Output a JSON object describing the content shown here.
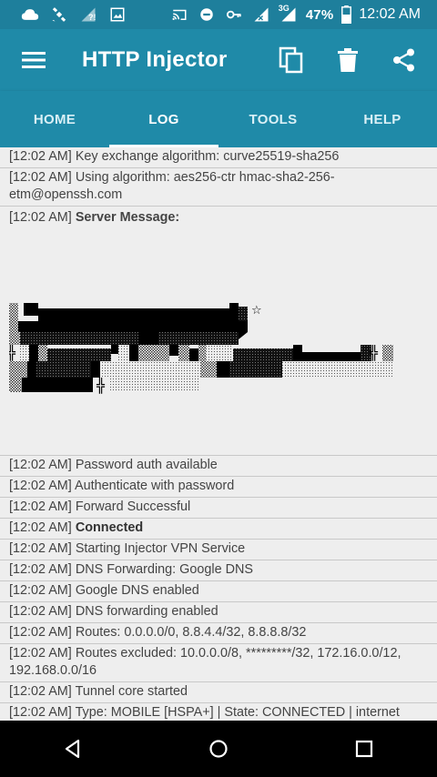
{
  "status_bar": {
    "left_icons": [
      "cloud-icon",
      "satellite-icon",
      "wifi-question-icon",
      "image-alert-icon"
    ],
    "right_icons": [
      "cast-icon",
      "do-not-disturb-icon",
      "vpn-key-icon",
      "signal-icon",
      "signal-3g-icon",
      "battery-icon"
    ],
    "network_type": "3G",
    "battery_percent": "47%",
    "time": "12:02 AM"
  },
  "app_bar": {
    "title": "HTTP Injector",
    "actions": [
      "copy-icon",
      "delete-icon",
      "share-icon"
    ]
  },
  "tabs": [
    {
      "label": "HOME",
      "active": false
    },
    {
      "label": "LOG",
      "active": true
    },
    {
      "label": "TOOLS",
      "active": false
    },
    {
      "label": "HELP",
      "active": false
    }
  ],
  "log": {
    "top_rows": [
      {
        "time": "[12:02 AM]",
        "text": "Key exchange algorithm: curve25519-sha256"
      },
      {
        "time": "[12:02 AM]",
        "text": "Using algorithm: aes256-ctr hmac-sha2-256-etm@openssh.com"
      }
    ],
    "server_message": {
      "time": "[12:02 AM]",
      "label": "Server Message:"
    },
    "bottom_rows": [
      {
        "time": "[12:02 AM]",
        "text": "Password auth available"
      },
      {
        "time": "[12:02 AM]",
        "text": "Authenticate with password"
      },
      {
        "time": "[12:02 AM]",
        "text": "Forward Successful"
      },
      {
        "time": "[12:02 AM]",
        "bold": "Connected"
      },
      {
        "time": "[12:02 AM]",
        "text": "Starting Injector VPN Service"
      },
      {
        "time": "[12:02 AM]",
        "text": "DNS Forwarding: Google DNS"
      },
      {
        "time": "[12:02 AM]",
        "text": "Google DNS enabled"
      },
      {
        "time": "[12:02 AM]",
        "text": "DNS forwarding enabled"
      },
      {
        "time": "[12:02 AM]",
        "text": "Routes: 0.0.0.0/0, 8.8.4.4/32, 8.8.8.8/32"
      },
      {
        "time": "[12:02 AM]",
        "text": "Routes excluded: 10.0.0.0/8, *********/32, 172.16.0.0/12, 192.168.0.0/16"
      },
      {
        "time": "[12:02 AM]",
        "text": "Tunnel core started"
      },
      {
        "time": "[12:02 AM]",
        "text": "Type: MOBILE [HSPA+] | State: CONNECTED | internet"
      }
    ]
  },
  "nav_bar": [
    "back-icon",
    "home-icon",
    "recents-icon"
  ]
}
